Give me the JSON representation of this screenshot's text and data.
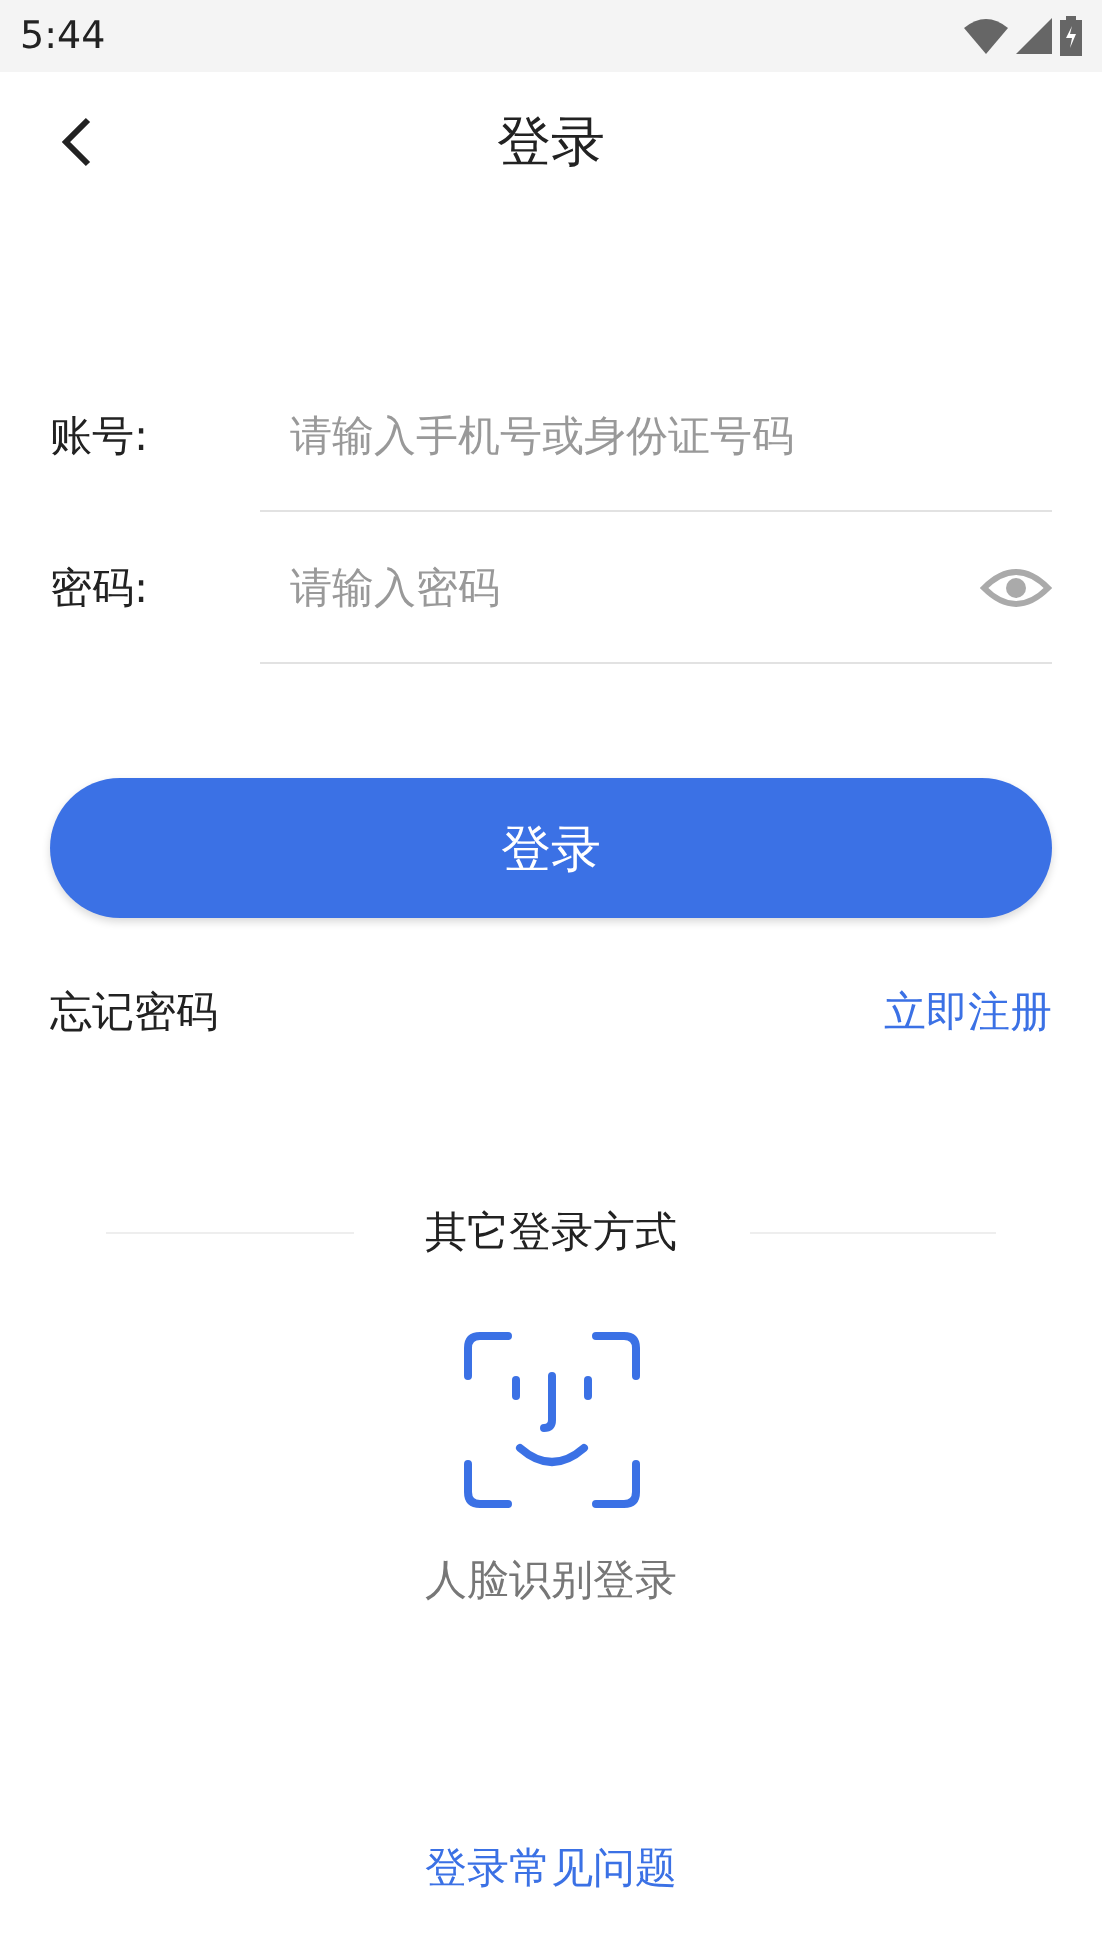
{
  "status_bar": {
    "time": "5:44"
  },
  "header": {
    "title": "登录"
  },
  "fields": [
    {
      "label": "账号:",
      "placeholder": "请输入手机号或身份证号码",
      "kind": "text"
    },
    {
      "label": "密码:",
      "placeholder": "请输入密码",
      "kind": "password"
    }
  ],
  "login_button": "登录",
  "forgot_link": "忘记密码",
  "register_link": "立即注册",
  "other_methods": {
    "title": "其它登录方式",
    "face_login": "人脸识别登录"
  },
  "help_link": "登录常见问题"
}
